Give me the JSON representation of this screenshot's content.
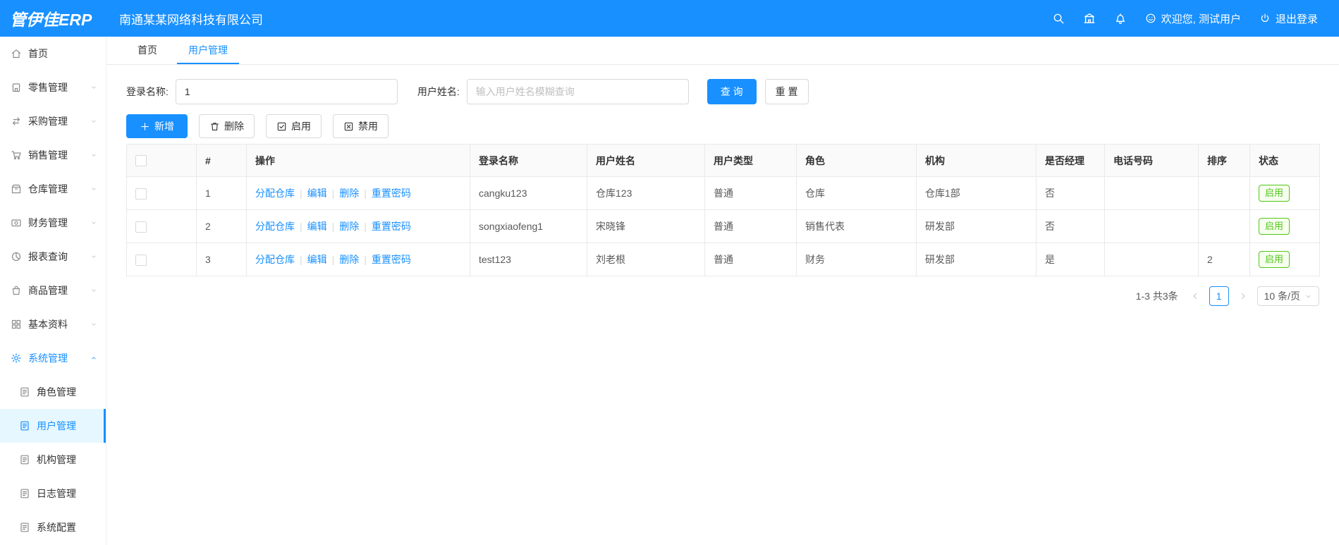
{
  "header": {
    "logo": "管伊佳ERP",
    "company": "南通某某网络科技有限公司",
    "welcome": "欢迎您, 测试用户",
    "logout": "退出登录"
  },
  "icons": {
    "header_icons": [
      "search-icon",
      "home-building-icon",
      "bell-icon"
    ],
    "welcome_icon": "user-smile-icon",
    "logout_icon": "power-icon"
  },
  "sidebar": {
    "items": [
      {
        "label": "首页",
        "icon": "home-icon"
      },
      {
        "label": "零售管理",
        "icon": "retail-icon"
      },
      {
        "label": "采购管理",
        "icon": "purchase-icon"
      },
      {
        "label": "销售管理",
        "icon": "sales-cart-icon"
      },
      {
        "label": "仓库管理",
        "icon": "warehouse-icon"
      },
      {
        "label": "财务管理",
        "icon": "finance-icon"
      },
      {
        "label": "报表查询",
        "icon": "report-icon"
      },
      {
        "label": "商品管理",
        "icon": "goods-icon"
      },
      {
        "label": "基本资料",
        "icon": "basic-data-icon"
      },
      {
        "label": "系统管理",
        "icon": "gear-icon"
      }
    ],
    "subitems": [
      {
        "label": "角色管理"
      },
      {
        "label": "用户管理"
      },
      {
        "label": "机构管理"
      },
      {
        "label": "日志管理"
      },
      {
        "label": "系统配置"
      }
    ]
  },
  "tabs": [
    {
      "label": "首页"
    },
    {
      "label": "用户管理"
    }
  ],
  "filters": {
    "login_name_label": "登录名称:",
    "login_name_value": "1",
    "user_name_label": "用户姓名:",
    "user_name_placeholder": "输入用户姓名模糊查询",
    "search_button": "查 询",
    "reset_button": "重 置"
  },
  "toolbar": {
    "add": "新增",
    "delete": "删除",
    "enable": "启用",
    "disable": "禁用"
  },
  "table": {
    "columns": [
      "#",
      "操作",
      "登录名称",
      "用户姓名",
      "用户类型",
      "角色",
      "机构",
      "是否经理",
      "电话号码",
      "排序",
      "状态"
    ],
    "action_links": [
      "分配仓库",
      "编辑",
      "删除",
      "重置密码"
    ],
    "rows": [
      {
        "index": "1",
        "login": "cangku123",
        "name": "仓库123",
        "type": "普通",
        "role": "仓库",
        "org": "仓库1部",
        "manager": "否",
        "phone": "",
        "sort": "",
        "status": "启用"
      },
      {
        "index": "2",
        "login": "songxiaofeng1",
        "name": "宋晓锋",
        "type": "普通",
        "role": "销售代表",
        "org": "研发部",
        "manager": "否",
        "phone": "",
        "sort": "",
        "status": "启用"
      },
      {
        "index": "3",
        "login": "test123",
        "name": "刘老根",
        "type": "普通",
        "role": "财务",
        "org": "研发部",
        "manager": "是",
        "phone": "",
        "sort": "2",
        "status": "启用"
      }
    ]
  },
  "pagination": {
    "total_text": "1-3 共3条",
    "current_page": "1",
    "page_size": "10 条/页"
  },
  "colors": {
    "primary": "#1890ff",
    "success": "#52c41a",
    "header_bg": "#1890ff",
    "active_menu_bg": "#e6f7ff"
  }
}
